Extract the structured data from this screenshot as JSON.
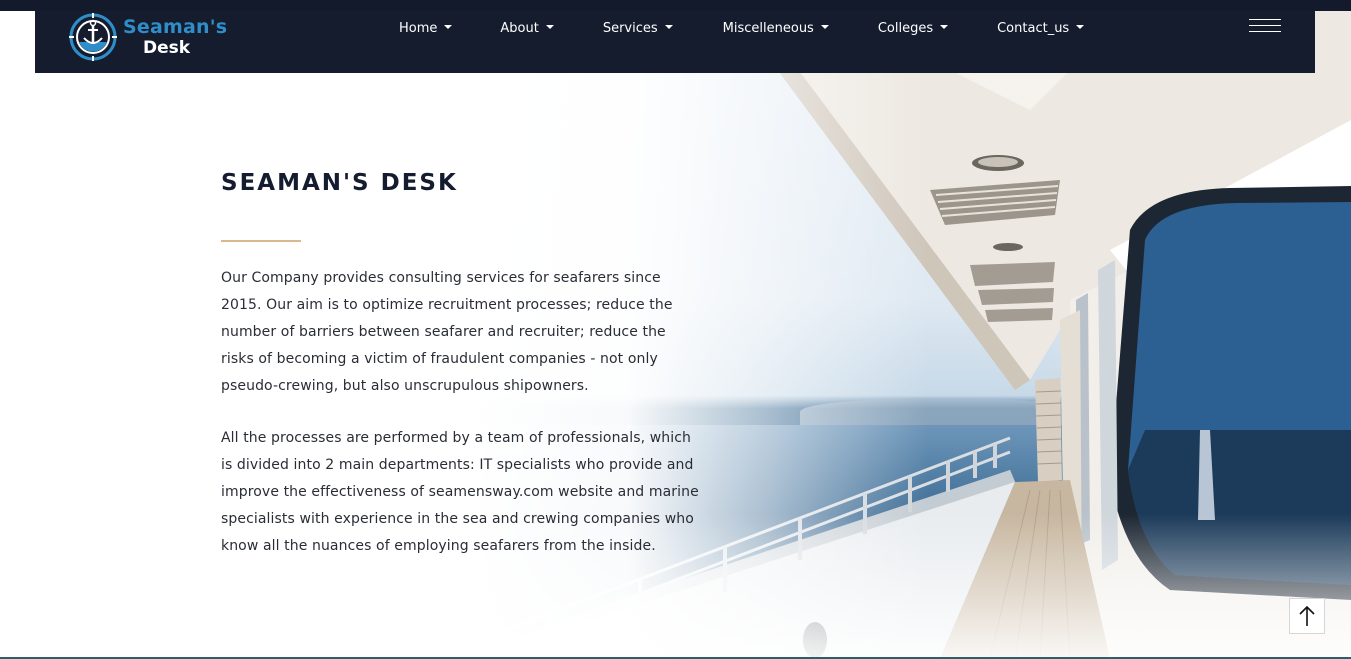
{
  "brand": {
    "line1": "Seaman's",
    "line2": "Desk",
    "primary_color": "#2f8ec9",
    "nav_background": "#141c2e"
  },
  "nav": {
    "items": [
      {
        "label": "Home",
        "icon": "caret-down-icon"
      },
      {
        "label": "About",
        "icon": "caret-down-icon"
      },
      {
        "label": "Services",
        "icon": "caret-down-icon"
      },
      {
        "label": "Miscelleneous",
        "icon": "caret-down-icon"
      },
      {
        "label": "Colleges",
        "icon": "caret-down-icon"
      },
      {
        "label": "Contact_us",
        "icon": "caret-down-icon"
      }
    ],
    "menu_icon": "hamburger-menu-icon"
  },
  "main": {
    "title": "SEAMAN'S DESK",
    "accent_color": "#d8b98f",
    "paragraphs": [
      "Our Company provides consulting services for seafarers since 2015. Our aim is to optimize recruitment processes; reduce the number of barriers between seafarer and recruiter; reduce the risks of becoming a victim of fraudulent companies - not only pseudo-crewing, but also unscrupulous shipowners.",
      "All the processes are performed by a team of professionals, which is divided into 2 main departments: IT specialists who provide and improve the effectiveness of seamensway.com website and marine specialists with experience in the sea and crewing companies who know all the nuances of employing seafarers from the inside."
    ]
  },
  "hero": {
    "image": "yacht-deck-photo"
  },
  "back_to_top": {
    "icon": "arrow-up-icon"
  }
}
